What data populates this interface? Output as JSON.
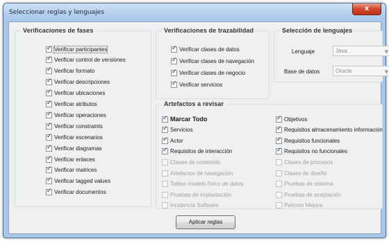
{
  "window": {
    "title": "Seleccionar reglas y lenguajes",
    "close_glyph": "x"
  },
  "phases": {
    "title": "Verificaciones de fases",
    "items": [
      {
        "label": "Verificar participantes",
        "checked": true
      },
      {
        "label": "Verificar control de versiones",
        "checked": true
      },
      {
        "label": "Verificar formato",
        "checked": true
      },
      {
        "label": "Verificar descripciones",
        "checked": true
      },
      {
        "label": "Verificar ubicaciones",
        "checked": true
      },
      {
        "label": "Verificar atributos",
        "checked": true
      },
      {
        "label": "Verificar operaciones",
        "checked": true
      },
      {
        "label": "Verificar constraints",
        "checked": true
      },
      {
        "label": "Verificar escenarios",
        "checked": true
      },
      {
        "label": "Verificar diagramas",
        "checked": true
      },
      {
        "label": "Verificar enlaces",
        "checked": true
      },
      {
        "label": "Verificar matrices",
        "checked": true
      },
      {
        "label": "Verificar tagged values",
        "checked": true
      },
      {
        "label": "Verificar documentos",
        "checked": true
      }
    ]
  },
  "traceability": {
    "title": "Verificaciones de trazabilidad",
    "items": [
      {
        "label": "Verificar clases de datos",
        "checked": true
      },
      {
        "label": "Verificar clases de navegación",
        "checked": true
      },
      {
        "label": "Verificar clases de negocio",
        "checked": true
      },
      {
        "label": "Verificar servicios",
        "checked": true
      }
    ]
  },
  "languages": {
    "title": "Selección de lenguajes",
    "language_label": "Lenguaje",
    "language_value": "Java",
    "database_label": "Base de datos",
    "database_value": "Oracle"
  },
  "artifacts": {
    "title": "Artefactos a revisar",
    "left": [
      {
        "label": "Marcar Todo",
        "checked": true,
        "bold": true
      },
      {
        "label": "Servicios",
        "checked": true
      },
      {
        "label": "Actor",
        "checked": true
      },
      {
        "label": "Requisitos de interacción",
        "checked": true
      },
      {
        "label": "Clases de contenido",
        "checked": false,
        "disabled": true
      },
      {
        "label": "Artefactos de navegación",
        "checked": false,
        "disabled": true
      },
      {
        "label": "Tablas modelo físico de datos",
        "checked": false,
        "disabled": true
      },
      {
        "label": "Pruebas de implantación",
        "checked": false,
        "disabled": true
      },
      {
        "label": "Incidencia Software",
        "checked": false,
        "disabled": true
      }
    ],
    "right": [
      {
        "label": "Objetivos",
        "checked": true
      },
      {
        "label": "Requisitos almacenamiento información",
        "checked": true
      },
      {
        "label": "Requisitos funcionales",
        "checked": true
      },
      {
        "label": "Requisitos no funcionales",
        "checked": true
      },
      {
        "label": "Clases de procesos",
        "checked": false,
        "disabled": true
      },
      {
        "label": "Clases de diseño",
        "checked": false,
        "disabled": true
      },
      {
        "label": "Pruebas de sistema",
        "checked": false,
        "disabled": true
      },
      {
        "label": "Pruebas de aceptación",
        "checked": false,
        "disabled": true
      },
      {
        "label": "Peticion Mejora",
        "checked": false,
        "disabled": true
      }
    ]
  },
  "footer": {
    "apply_label": "Aplicar reglas"
  }
}
